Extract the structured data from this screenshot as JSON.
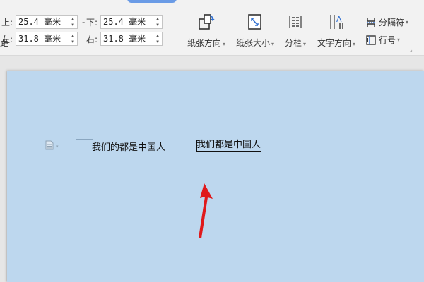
{
  "ribbon": {
    "left_fragment_top": "",
    "left_fragment_bottom": "距",
    "margins": {
      "top": {
        "label": "上:",
        "value": "25.4 毫米"
      },
      "bottom": {
        "label": "下:",
        "value": "25.4 毫米"
      },
      "left": {
        "label": "左:",
        "value": "31.8 毫米"
      },
      "right": {
        "label": "右:",
        "value": "31.8 毫米"
      }
    },
    "tools": {
      "orientation": "纸张方向",
      "size": "纸张大小",
      "columns": "分栏",
      "text_direction": "文字方向",
      "breaks": "分隔符",
      "line_numbers": "行号"
    }
  },
  "document": {
    "text_1": "我们的都是中国人",
    "text_2": "我们都是中国人"
  },
  "colors": {
    "page": "#bdd7ee",
    "arrow": "#e0191b",
    "accent": "#2f6fd1"
  },
  "icons": [
    "orientation-icon",
    "paper-size-icon",
    "columns-icon",
    "text-direction-icon",
    "breaks-icon",
    "line-numbers-icon",
    "paragraph-icon"
  ]
}
